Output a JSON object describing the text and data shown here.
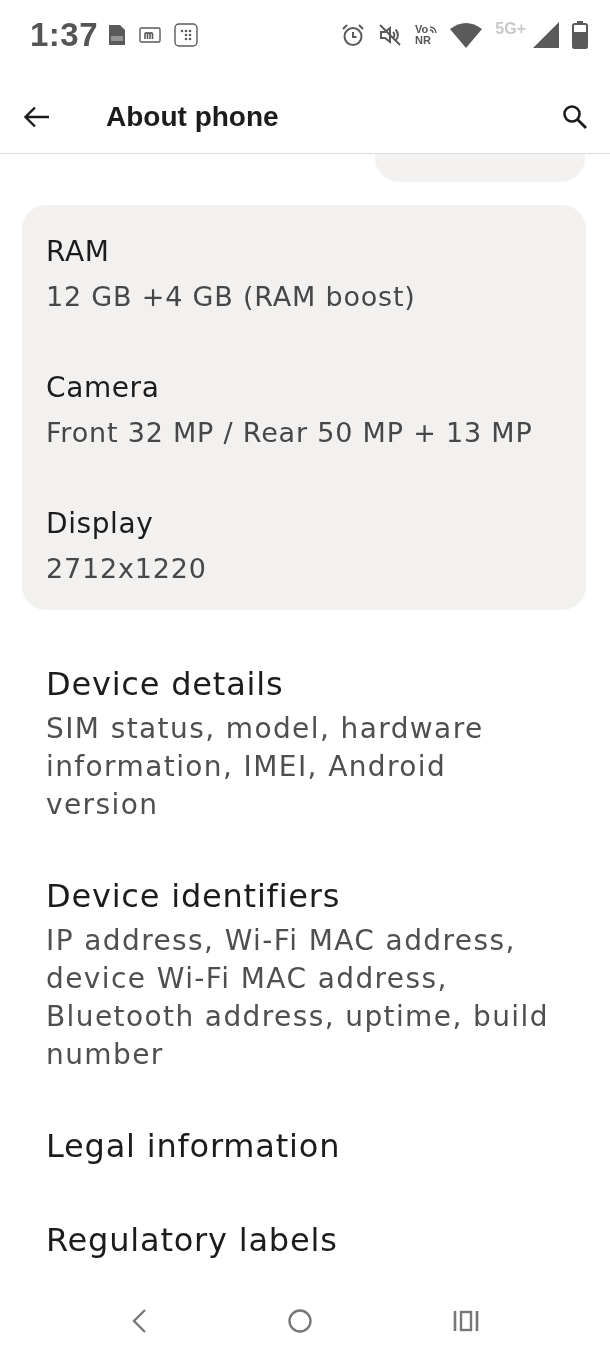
{
  "status_bar": {
    "time": "1:37",
    "vonr_top": "Vo",
    "vonr_bottom": "NR",
    "network": {
      "label": "5G+",
      "active": false
    }
  },
  "header": {
    "title": "About phone"
  },
  "spec_card": {
    "items": [
      {
        "label": "RAM",
        "value": "12 GB +4 GB (RAM boost)"
      },
      {
        "label": "Camera",
        "value": "Front 32 MP / Rear 50 MP + 13 MP"
      },
      {
        "label": "Display",
        "value": "2712x1220"
      }
    ]
  },
  "entries": [
    {
      "title": "Device details",
      "summary": "SIM status, model, hardware information, IMEI, Android version"
    },
    {
      "title": "Device identifiers",
      "summary": "IP address, Wi-Fi MAC address, device Wi-Fi MAC address, Bluetooth address, uptime, build number"
    },
    {
      "title": "Legal information"
    },
    {
      "title": "Regulatory labels"
    }
  ]
}
